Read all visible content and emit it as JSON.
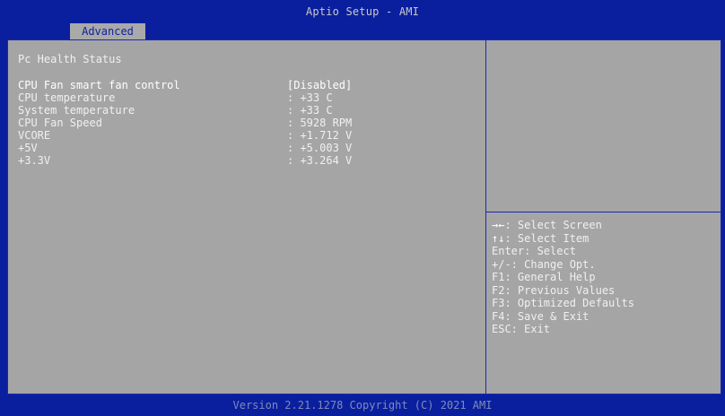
{
  "header": {
    "title": "Aptio Setup - AMI",
    "tabs": [
      {
        "label": "Advanced",
        "active": true
      }
    ]
  },
  "page": {
    "section_title": "Pc Health Status",
    "items": [
      {
        "label": "CPU Fan smart fan control",
        "value": "[Disabled]",
        "selected": true
      },
      {
        "label": "CPU temperature",
        "value": ": +33 C"
      },
      {
        "label": "System temperature",
        "value": ": +33 C"
      },
      {
        "label": "CPU Fan Speed",
        "value": ": 5928 RPM"
      },
      {
        "label": "VCORE",
        "value": ": +1.712 V"
      },
      {
        "label": "+5V",
        "value": ": +5.003 V"
      },
      {
        "label": "+3.3V",
        "value": ": +3.264 V"
      }
    ]
  },
  "help": {
    "lines": [
      {
        "key": "→←",
        "text": ": Select Screen"
      },
      {
        "key": "↑↓",
        "text": ": Select Item"
      },
      {
        "key": "",
        "text": "Enter: Select"
      },
      {
        "key": "",
        "text": "+/-: Change Opt."
      },
      {
        "key": "",
        "text": "F1: General Help"
      },
      {
        "key": "",
        "text": "F2: Previous Values"
      },
      {
        "key": "",
        "text": "F3: Optimized Defaults"
      },
      {
        "key": "",
        "text": "F4: Save & Exit"
      },
      {
        "key": "",
        "text": "ESC: Exit"
      }
    ]
  },
  "footer": {
    "text": "Version 2.21.1278 Copyright (C) 2021 AMI"
  },
  "colors": {
    "background_blue": "#0a1f9e",
    "panel_gray": "#a5a5a5",
    "text_white": "#f0f0f0",
    "footer_text": "#7f8ab8"
  }
}
